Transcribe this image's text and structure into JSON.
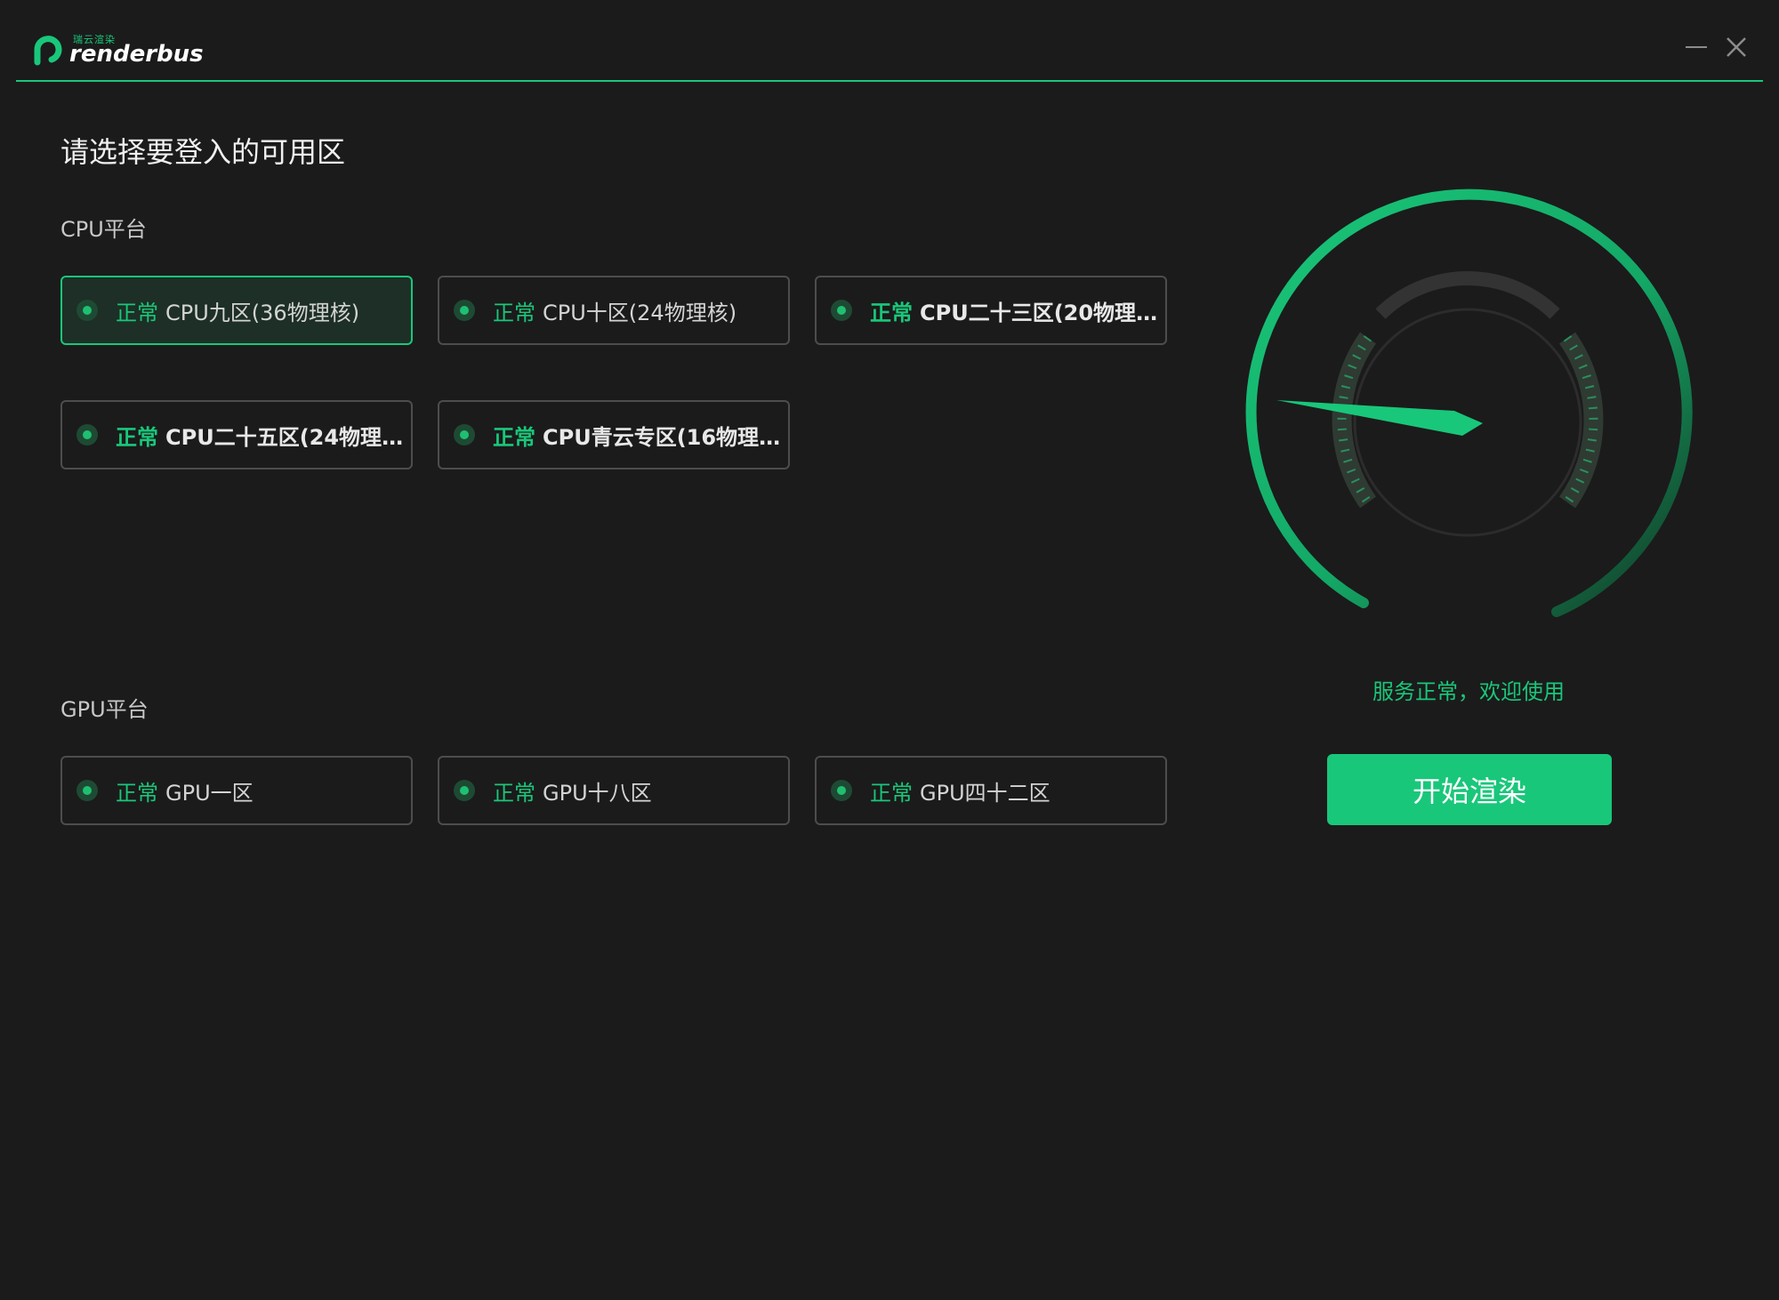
{
  "app": {
    "brand_small": "瑞云渲染",
    "brand": "renderbus",
    "accent_color": "#19c77a"
  },
  "window_controls": {
    "minimize_icon": "minimize-icon",
    "close_icon": "close-icon"
  },
  "main": {
    "title": "请选择要登入的可用区",
    "cpu_section_label": "CPU平台",
    "gpu_section_label": "GPU平台",
    "cpu_zones": [
      {
        "status": "正常",
        "name": "CPU九区(36物理核)",
        "selected": true
      },
      {
        "status": "正常",
        "name": "CPU十区(24物理核)",
        "selected": false
      },
      {
        "status": "正常",
        "name": "CPU二十三区(20物理...",
        "selected": false
      },
      {
        "status": "正常",
        "name": "CPU二十五区(24物理...",
        "selected": false
      },
      {
        "status": "正常",
        "name": "CPU青云专区(16物理...",
        "selected": false
      }
    ],
    "gpu_zones": [
      {
        "status": "正常",
        "name": "GPU一区",
        "selected": false
      },
      {
        "status": "正常",
        "name": "GPU十八区",
        "selected": false
      },
      {
        "status": "正常",
        "name": "GPU四十二区",
        "selected": false
      }
    ]
  },
  "status_panel": {
    "gauge_icon": "speedometer-gauge-icon",
    "service_text": "服务正常，欢迎使用",
    "start_button": "开始渲染"
  }
}
